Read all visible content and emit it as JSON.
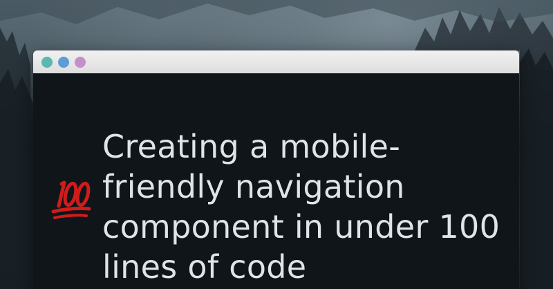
{
  "window": {
    "controls": [
      {
        "name": "close",
        "color": "#5bb7b0"
      },
      {
        "name": "minimize",
        "color": "#5f9bd6"
      },
      {
        "name": "maximize",
        "color": "#c58fc9"
      }
    ]
  },
  "content": {
    "emoji": {
      "icon": "hundred-points-icon",
      "glyph_text": "100",
      "color": "#d11c1c"
    },
    "headline_lines": [
      "Creating a mobile-",
      "friendly navigation",
      "component in under 100",
      "lines of code"
    ]
  },
  "colors": {
    "window_body": "#101519",
    "headline_text": "#dfe4ea",
    "titlebar": "#e8e8e8"
  }
}
